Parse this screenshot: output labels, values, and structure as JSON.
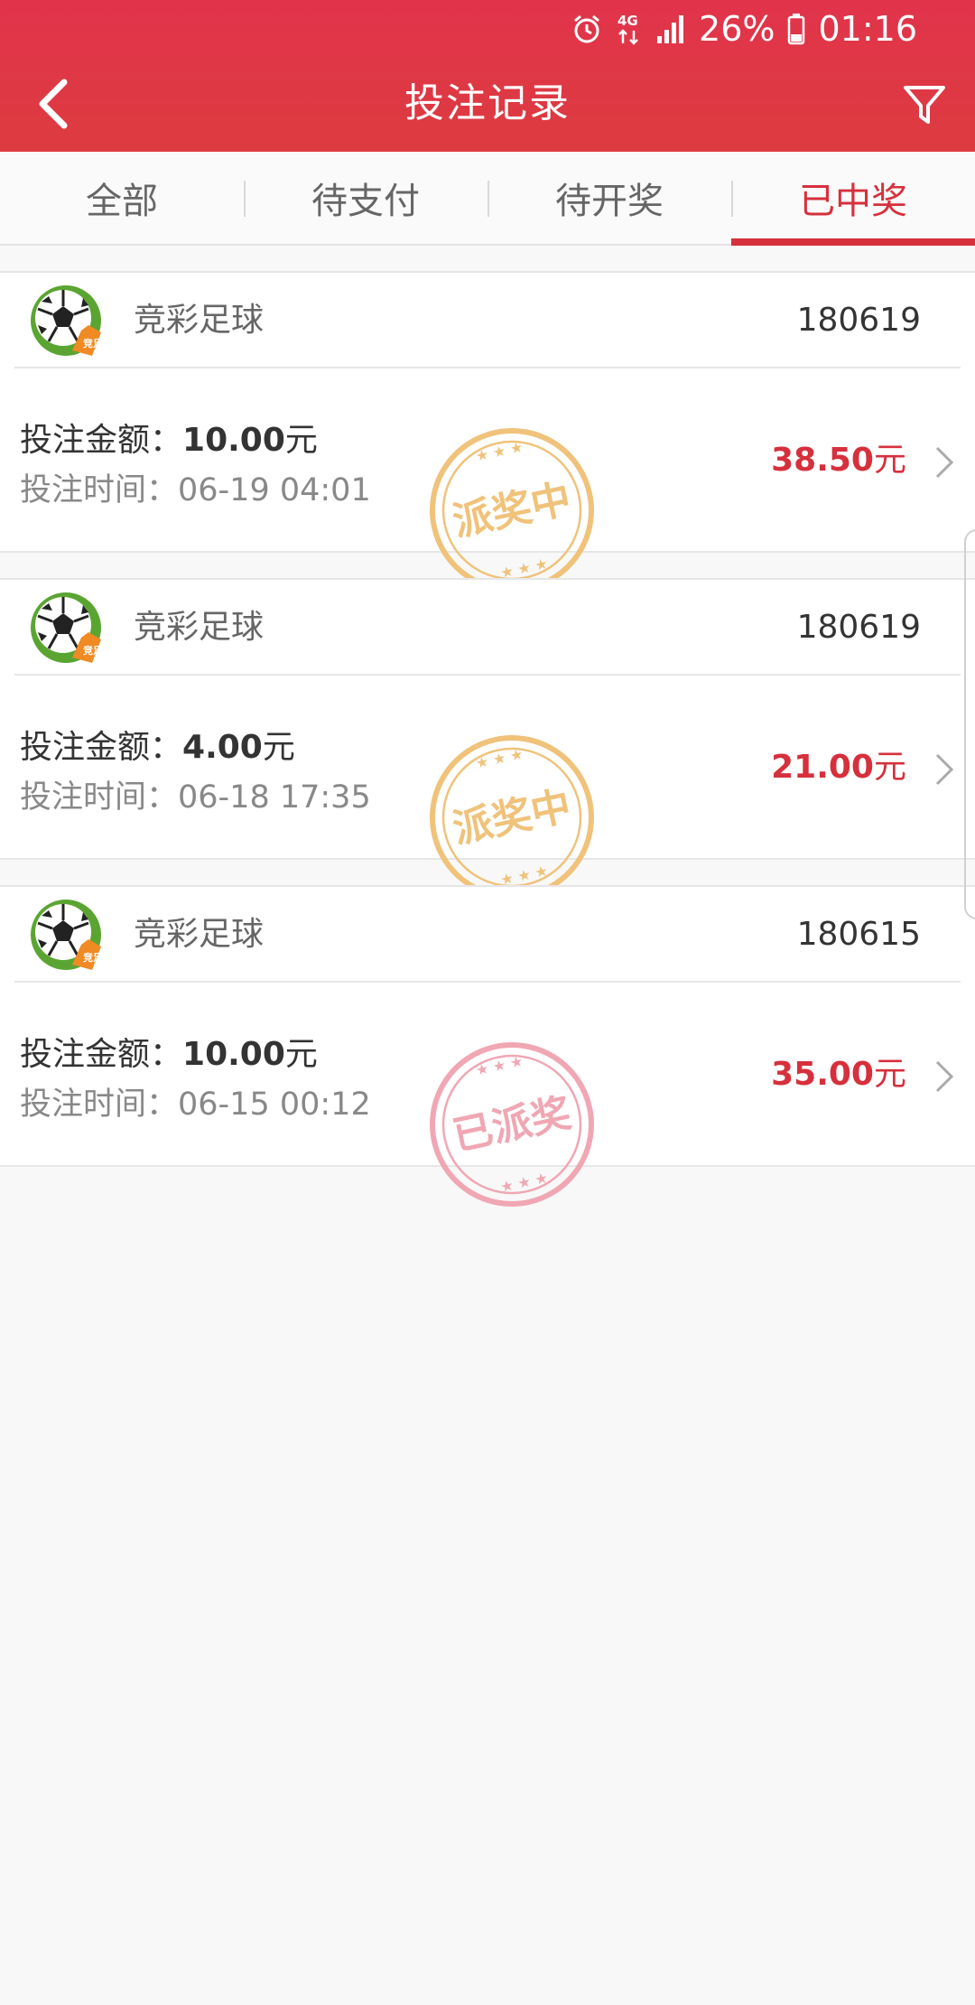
{
  "status_bar": {
    "icons": [
      "alarm-icon",
      "network-4g-icon",
      "signal-icon",
      "battery-icon"
    ],
    "battery": "26%",
    "time": "01:16"
  },
  "header": {
    "title": "投注记录",
    "back_icon": "chevron-left-icon",
    "filter_icon": "filter-icon"
  },
  "tabs": [
    {
      "label": "全部",
      "active": false
    },
    {
      "label": "待支付",
      "active": false
    },
    {
      "label": "待开奖",
      "active": false
    },
    {
      "label": "已中奖",
      "active": true
    }
  ],
  "labels": {
    "amount_prefix": "投注金额：",
    "time_prefix": "投注时间：",
    "currency_unit": "元"
  },
  "records": [
    {
      "lottery": "竞彩足球",
      "issue": "180619",
      "amount": "10.00",
      "time": "06-19 04:01",
      "prize": "38.50",
      "stamp": "派奖中",
      "stamp_color": "#f0c27a"
    },
    {
      "lottery": "竞彩足球",
      "issue": "180619",
      "amount": "4.00",
      "time": "06-18 17:35",
      "prize": "21.00",
      "stamp": "派奖中",
      "stamp_color": "#f0c27a"
    },
    {
      "lottery": "竞彩足球",
      "issue": "180615",
      "amount": "10.00",
      "time": "06-15 00:12",
      "prize": "35.00",
      "stamp": "已派奖",
      "stamp_color": "#f0a7b3"
    }
  ],
  "colors": {
    "brand_red": "#dd3b40",
    "accent": "#d6303c"
  }
}
